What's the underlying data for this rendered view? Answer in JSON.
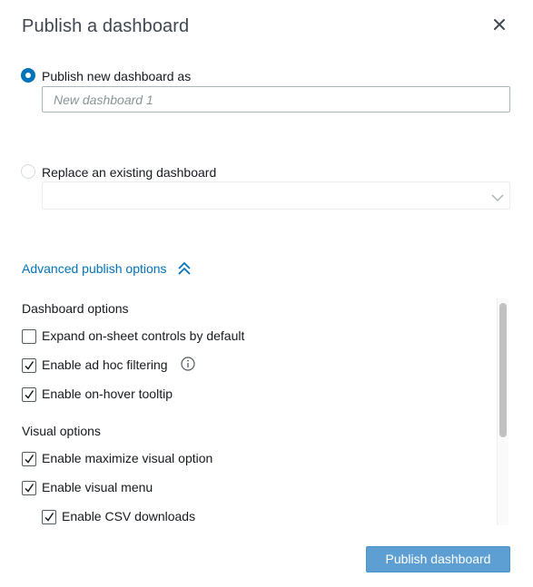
{
  "dialog": {
    "title": "Publish a dashboard",
    "close_icon": "close-icon"
  },
  "publish_new": {
    "label": "Publish new dashboard as",
    "selected": true,
    "input_value": "",
    "input_placeholder": "New dashboard 1"
  },
  "replace_existing": {
    "label": "Replace an existing dashboard",
    "selected": false,
    "select_value": "",
    "select_icon": "chevron-down-icon"
  },
  "advanced": {
    "label": "Advanced publish options",
    "icon": "chevron-double-up-icon",
    "expanded": true
  },
  "dashboard_options": {
    "heading": "Dashboard options",
    "items": [
      {
        "label": "Expand on-sheet controls by default",
        "checked": false
      },
      {
        "label": "Enable ad hoc filtering",
        "checked": true,
        "info_icon": "info-icon"
      },
      {
        "label": "Enable on-hover tooltip",
        "checked": true
      }
    ]
  },
  "visual_options": {
    "heading": "Visual options",
    "items": [
      {
        "label": "Enable maximize visual option",
        "checked": true
      },
      {
        "label": "Enable visual menu",
        "checked": true
      },
      {
        "label": "Enable CSV downloads",
        "checked": true
      }
    ]
  },
  "footer": {
    "publish_label": "Publish dashboard"
  },
  "colors": {
    "accent": "#0073bb",
    "button": "#5d9fd2",
    "text": "#16191f",
    "title": "#414750"
  }
}
